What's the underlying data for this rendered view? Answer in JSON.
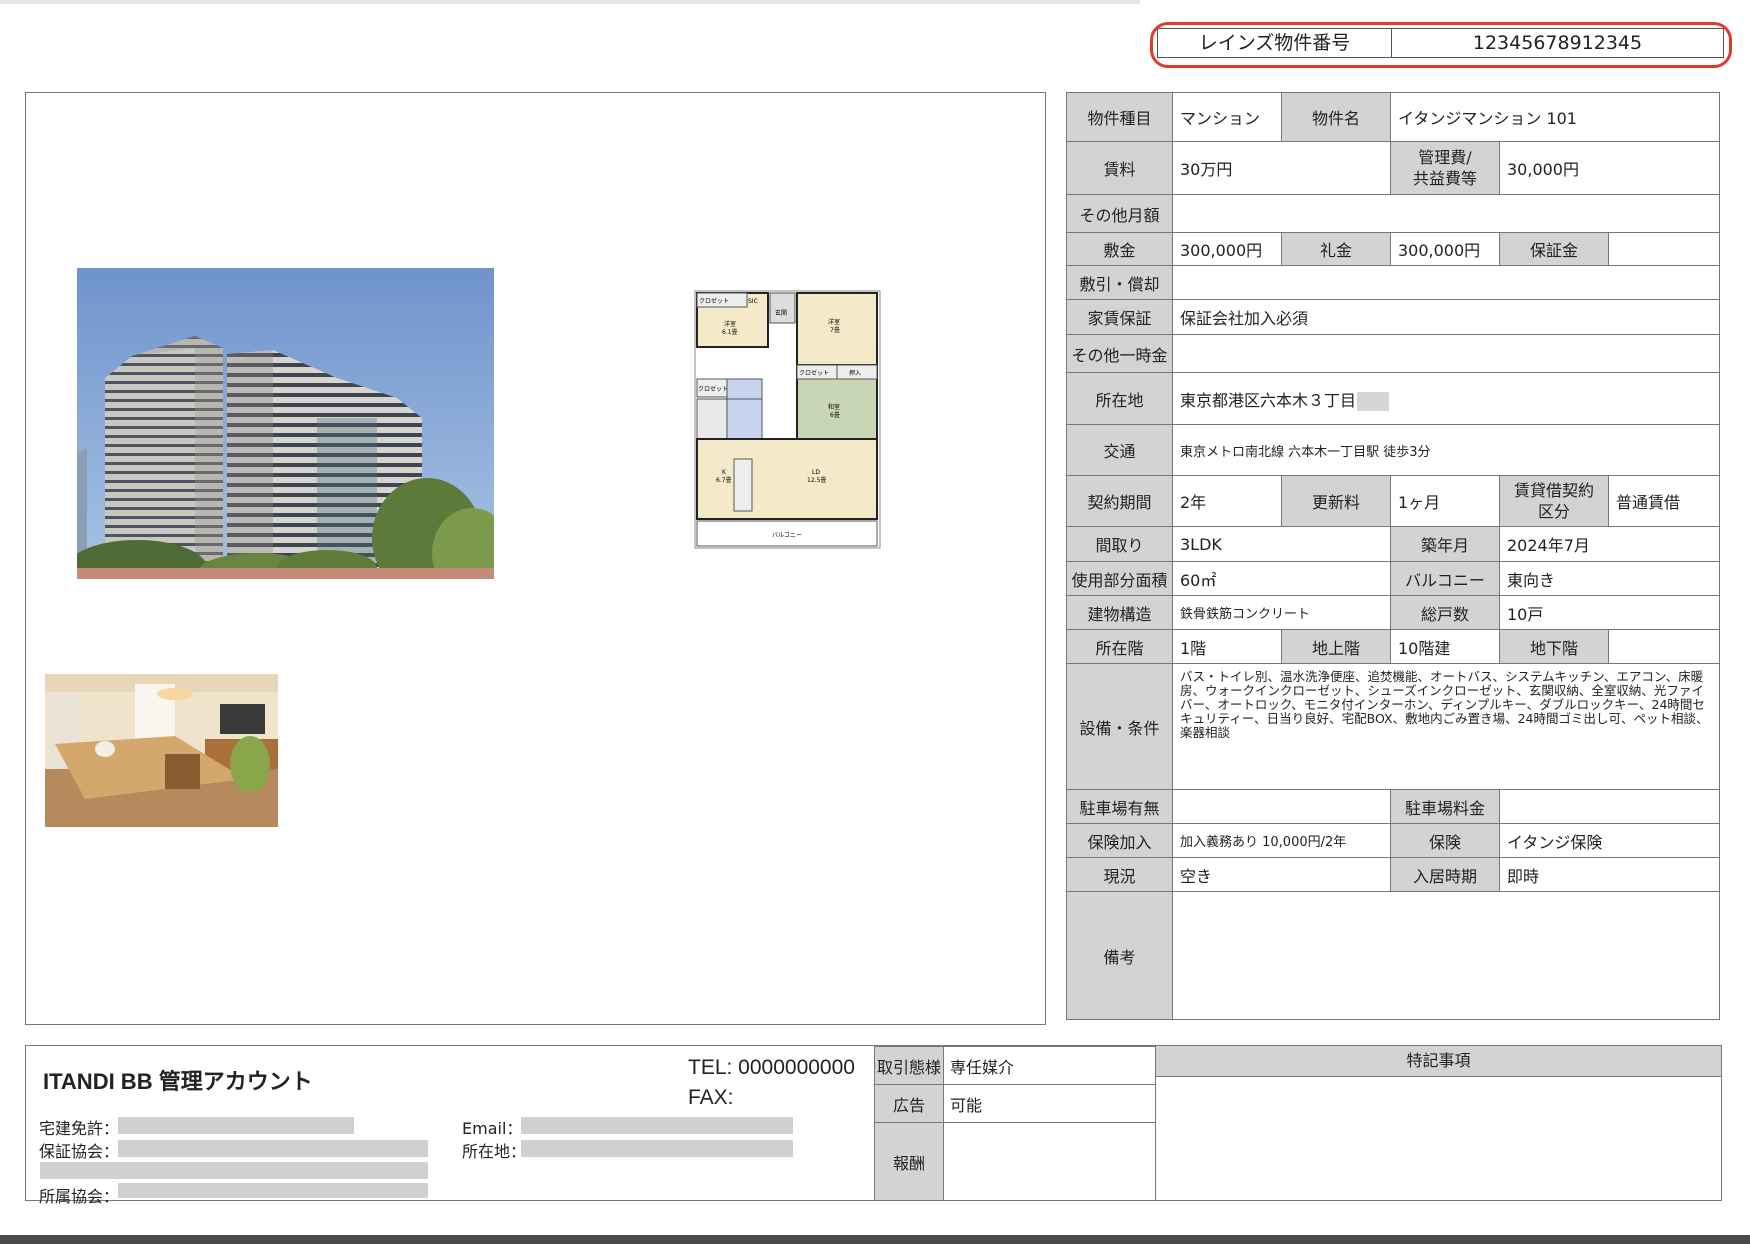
{
  "reins": {
    "label": "レインズ物件番号",
    "number": "12345678912345"
  },
  "property": {
    "type_label": "物件種目",
    "type": "マンション",
    "name_label": "物件名",
    "name": "イタンジマンション 101",
    "rent_label": "賃料",
    "rent": "30万円",
    "mgmt_label_1": "管理費/",
    "mgmt_label_2": "共益費等",
    "mgmt": "30,000円",
    "other_monthly_label": "その他月額",
    "other_monthly": "",
    "deposit_label": "敷金",
    "deposit": "300,000円",
    "key_money_label": "礼金",
    "key_money": "300,000円",
    "guarantee_money_label": "保証金",
    "guarantee_money": "",
    "shikibiki_label": "敷引・償却",
    "shikibiki": "",
    "rent_guarantee_label": "家賃保証",
    "rent_guarantee": "保証会社加入必須",
    "other_onetime_label": "その他一時金",
    "other_onetime": "",
    "address_label": "所在地",
    "address": "東京都港区六本木３丁目",
    "transport_label": "交通",
    "transport": "東京メトロ南北線 六本木一丁目駅 徒歩3分",
    "contract_period_label": "契約期間",
    "contract_period": "2年",
    "renewal_fee_label": "更新料",
    "renewal_fee": "1ヶ月",
    "contract_type_label_1": "賃貸借契約",
    "contract_type_label_2": "区分",
    "contract_type": "普通賃借",
    "layout_label": "間取り",
    "layout": "3LDK",
    "built_label": "築年月",
    "built": "2024年7月",
    "area_label": "使用部分面積",
    "area": "60㎡",
    "balcony_label": "バルコニー",
    "balcony": "東向き",
    "structure_label": "建物構造",
    "structure": "鉄骨鉄筋コンクリート",
    "total_units_label": "総戸数",
    "total_units": "10戸",
    "floor_label": "所在階",
    "floor": "1階",
    "above_label": "地上階",
    "above": "10階建",
    "below_label": "地下階",
    "below": "",
    "equipment_label": "設備・条件",
    "equipment": "バス・トイレ別、温水洗浄便座、追焚機能、オートバス、システムキッチン、エアコン、床暖房、ウォークインクローゼット、シューズインクローゼット、玄関収納、全室収納、光ファイバー、オートロック、モニタ付インターホン、ディンプルキー、ダブルロックキー、24時間セキュリティー、日当り良好、宅配BOX、敷地内ごみ置き場、24時間ゴミ出し可、ペット相談、楽器相談",
    "parking_label": "駐車場有無",
    "parking": "",
    "parking_fee_label": "駐車場料金",
    "parking_fee": "",
    "insurance_req_label": "保険加入",
    "insurance_req": "加入義務あり 10,000円/2年",
    "insurance_label": "保険",
    "insurance": "イタンジ保険",
    "status_label": "現況",
    "status": "空き",
    "move_in_label": "入居時期",
    "move_in": "即時",
    "remarks_label": "備考",
    "remarks": ""
  },
  "floorplan": {
    "closet1": "クロゼット",
    "sic": "SIC",
    "entrance": "玄関",
    "room1": "洋室",
    "room1_size": "6.1畳",
    "room2": "洋室",
    "room2_size": "7畳",
    "closet2": "クロゼット",
    "oshiire": "押入",
    "washitsu": "和室",
    "washitsu_size": "6畳",
    "closet3": "クロゼット",
    "kitchen": "K",
    "kitchen_size": "6.7畳",
    "ld": "LD",
    "ld_size": "12.5畳",
    "balcony": "バルコニー"
  },
  "footer": {
    "company": "ITANDI BB 管理アカウント",
    "tel": "TEL: 0000000000",
    "fax": "FAX:",
    "license_label": "宅建免許：",
    "guarantee_assoc_label": "保証協会：",
    "affiliation_label": "所属協会：",
    "email_label": "Email：",
    "address_label": "所在地：",
    "deal_type_label": "取引態様",
    "deal_type": "専任媒介",
    "ad_label": "広告",
    "ad": "可能",
    "fee_label": "報酬",
    "fee": "",
    "special_label": "特記事項",
    "special": ""
  }
}
